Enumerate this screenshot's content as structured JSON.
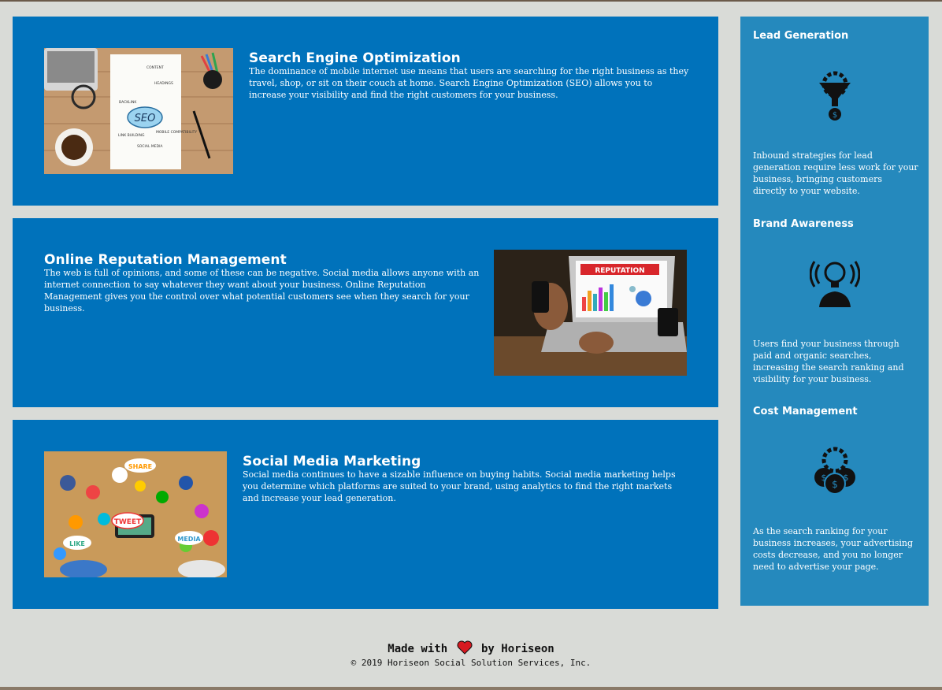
{
  "services": [
    {
      "title": "Search Engine Optimization",
      "body": "The dominance of mobile internet use means that users are searching for the right business as they travel, shop, or sit on their couch at home. Search Engine Optimization (SEO) allows you to increase your visibility and find the right customers for your business.",
      "image_label": "SEO",
      "image_words": [
        "BACKLINK",
        "CONTENT",
        "HEADINGS",
        "LINK BUILDING",
        "MOBILE COMPATIBILITY",
        "SOCIAL MEDIA"
      ]
    },
    {
      "title": "Online Reputation Management",
      "body": "The web is full of opinions, and some of these can be negative. Social media allows anyone with an internet connection to say whatever they want about your business. Online Reputation Management gives you the control over what potential customers see when they search for your business.",
      "image_label": "REPUTATION"
    },
    {
      "title": "Social Media Marketing",
      "body": "Social media continues to have a sizable influence on buying habits. Social media marketing helps you determine which platforms are suited to your brand, using analytics to find the right markets and increase your lead generation.",
      "image_words": [
        "SHARE",
        "TWEET",
        "LIKE",
        "MEDIA"
      ]
    }
  ],
  "benefits": [
    {
      "title": "Lead Generation",
      "icon": "lead-funnel-icon",
      "body": "Inbound strategies for lead generation require less work for your business, bringing customers directly to your website."
    },
    {
      "title": "Brand Awareness",
      "icon": "brand-lightbulb-icon",
      "body": "Users find your business through paid and organic searches, increasing the search ranking and visibility for your business."
    },
    {
      "title": "Cost Management",
      "icon": "cost-coins-icon",
      "body": "As the search ranking for your business increases, your advertising costs decrease, and you no longer need to advertise your page."
    }
  ],
  "footer": {
    "made_prefix": "Made with",
    "made_suffix": "by Horiseon",
    "copyright": "© 2019 Horiseon Social Solution Services, Inc."
  },
  "colors": {
    "page_bg": "#d9dbd7",
    "card_bg": "#0072bb",
    "aside_bg": "#2589bd",
    "heart": "#d71920"
  }
}
